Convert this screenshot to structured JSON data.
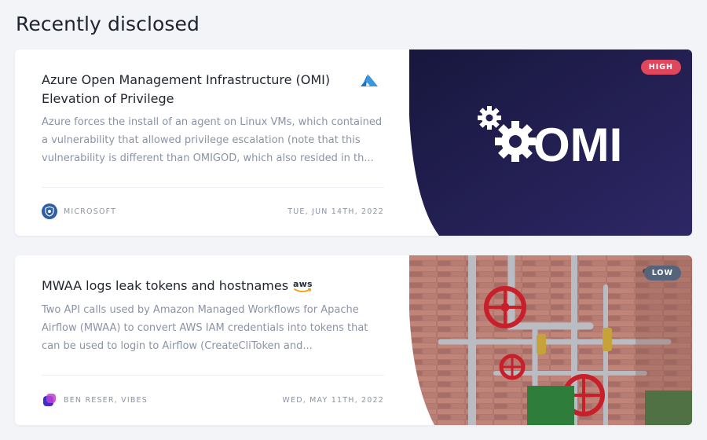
{
  "section": {
    "title": "Recently disclosed"
  },
  "cards": [
    {
      "title": "Azure Open Management Infrastructure (OMI) Elevation of Privilege",
      "description": "Azure forces the install of an agent on Linux VMs, which contained a vulnerability that allowed privilege escalation (note that this vulnerability is different than OMIGOD, which also resided in th...",
      "author": "MICROSOFT",
      "date": "TUE, JUN 14TH, 2022",
      "severity": "HIGH",
      "vendor_icon": "azure-icon",
      "media_text": "OMI",
      "media_icon": "gears-icon"
    },
    {
      "title": "MWAA logs leak tokens and hostnames",
      "description": "Two API calls used by Amazon Managed Workflows for Apache Airflow (MWAA) to convert AWS IAM credentials into tokens that can be used to login to Airflow (CreateCliToken and...",
      "author": "BEN RESER, VIBES",
      "date": "WED, MAY 11TH, 2022",
      "severity": "LOW",
      "vendor_icon": "aws-icon",
      "vendor_text": "aws",
      "media_icon": "pipes-valves-photo"
    }
  ],
  "colors": {
    "high": "#e0475d",
    "low": "#55647a",
    "omi_bg": "#1f1c4a"
  }
}
